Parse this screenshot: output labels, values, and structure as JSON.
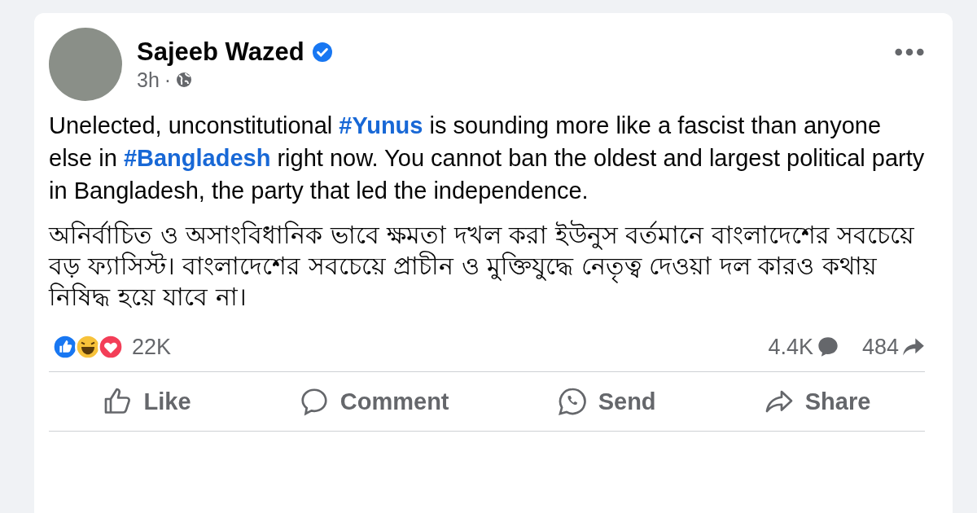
{
  "post": {
    "author": "Sajeeb Wazed",
    "verified": true,
    "time": "3h",
    "separator": "·",
    "paragraphs": [
      {
        "parts": [
          {
            "kind": "text",
            "text": "Unelected, unconstitutional "
          },
          {
            "kind": "hashtag",
            "text": "#Yunus"
          },
          {
            "kind": "text",
            "text": " is sounding more like a fascist than anyone else in "
          },
          {
            "kind": "hashtag",
            "text": "#Bangladesh"
          },
          {
            "kind": "text",
            "text": " right now. You cannot ban the oldest and largest political party in Bangladesh, the party that led the independence."
          }
        ]
      },
      {
        "parts": [
          {
            "kind": "text",
            "text": "অনির্বাচিত ও অসাংবিধানিক ভাবে ক্ষমতা দখল করা ইউনুস বর্তমানে বাংলাদেশের সবচেয়ে বড় ফ্যাসিস্ট। বাংলাদেশের সবচেয়ে প্রাচীন ও মুক্তিযুদ্ধে নেতৃত্ব দেওয়া দল কারও কথায় নিষিদ্ধ হয়ে যাবে না।"
          }
        ]
      }
    ],
    "reactions": [
      {
        "kind": "like"
      },
      {
        "kind": "haha"
      },
      {
        "kind": "love"
      }
    ],
    "reaction_count": "22K",
    "comment_count": "4.4K",
    "share_count": "484",
    "actions": [
      {
        "kind": "like",
        "label": "Like"
      },
      {
        "kind": "comment",
        "label": "Comment"
      },
      {
        "kind": "send",
        "label": "Send"
      },
      {
        "kind": "share",
        "label": "Share"
      }
    ]
  }
}
